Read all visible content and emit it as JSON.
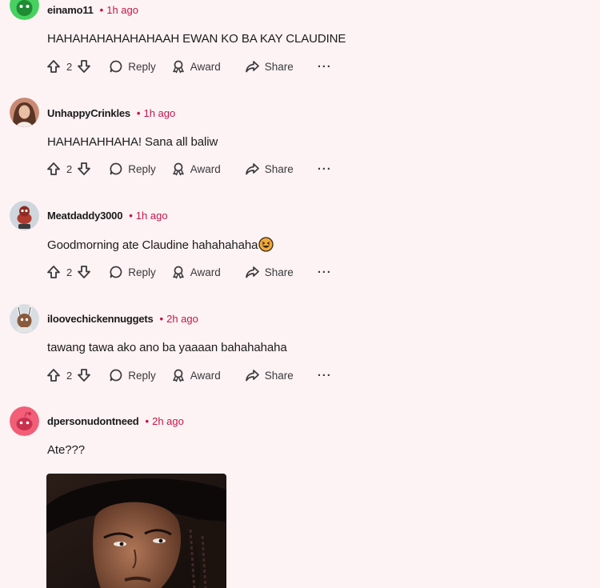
{
  "comments": [
    {
      "author": "einamo11",
      "time": "1h ago",
      "text": "HAHAHAHAHAHAHAAH EWAN KO BA KAY CLAUDINE",
      "score": "2"
    },
    {
      "author": "UnhappyCrinkles",
      "time": "1h ago",
      "text": "HAHAHAHHAHA! Sana all baliw",
      "score": "2"
    },
    {
      "author": "Meatdaddy3000",
      "time": "1h ago",
      "text": "Goodmorning ate Claudine hahahahaha",
      "score": "2"
    },
    {
      "author": "iloovechickennuggets",
      "time": "2h ago",
      "text": "tawang tawa ako ano ba yaaaan bahahahaha",
      "score": "2"
    },
    {
      "author": "dpersonudontneed",
      "time": "2h ago",
      "text": "Ate???"
    }
  ],
  "actions": {
    "reply": "Reply",
    "award": "Award",
    "share": "Share",
    "more": "···"
  },
  "meta": {
    "separator": "•"
  },
  "colors": {
    "background": "#fdf2f4",
    "time": "#c4164b",
    "text": "#1c1c1c"
  },
  "icons": {
    "upvote": "upvote-icon",
    "downvote": "downvote-icon",
    "reply": "speech-bubble-icon",
    "award": "award-icon",
    "share": "share-arrow-icon",
    "emoji": "laughing-emoji-icon"
  }
}
